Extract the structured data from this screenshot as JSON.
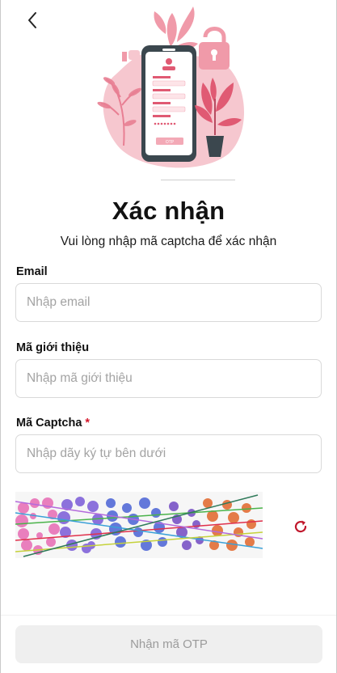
{
  "header": {
    "back_icon": "chevron-left-icon"
  },
  "hero": {
    "illustration": "phone-otp-illustration",
    "phone_button_text": "OTP"
  },
  "page": {
    "title": "Xác nhận",
    "subtitle": "Vui lòng nhập mã captcha để xác nhận"
  },
  "form": {
    "email": {
      "label": "Email",
      "placeholder": "Nhập email",
      "value": ""
    },
    "referral": {
      "label": "Mã giới thiệu",
      "placeholder": "Nhập mã giới thiệu",
      "value": ""
    },
    "captcha": {
      "label": "Mã Captcha",
      "required_mark": "*",
      "placeholder": "Nhập dãy ký tự bên dưới",
      "value": ""
    }
  },
  "captcha_image": {
    "refresh_icon": "refresh-icon"
  },
  "footer": {
    "submit_label": "Nhận mã OTP"
  },
  "colors": {
    "accent": "#d4172a",
    "illustration_pink": "#f3a9b6",
    "illustration_dark": "#3b474e",
    "disabled_bg": "#efefef",
    "disabled_text": "#9b9b9b"
  }
}
